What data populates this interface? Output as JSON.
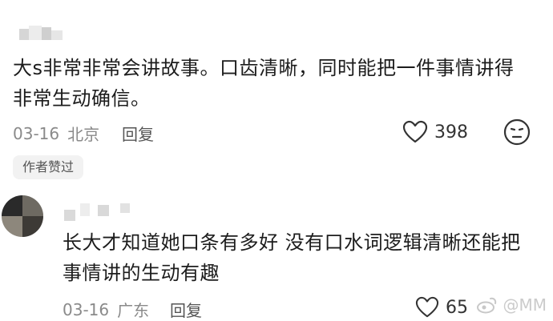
{
  "comments": [
    {
      "text_line1": "大s非常非常会讲故事。口齿清晰，同时能把一件事情讲得",
      "text_line2": "非常生动确信。",
      "date": "03-16",
      "location": "北京",
      "reply_label": "回复",
      "likes": "398",
      "author_liked_badge": "作者赞过"
    },
    {
      "text_line1": "长大才知道她口条有多好 没有口水词逻辑清晰还能把",
      "text_line2": "事情讲的生动有趣",
      "date": "03-16",
      "location": "广东",
      "reply_label": "回复",
      "likes": "65"
    }
  ],
  "watermark": {
    "text": "@MM"
  }
}
